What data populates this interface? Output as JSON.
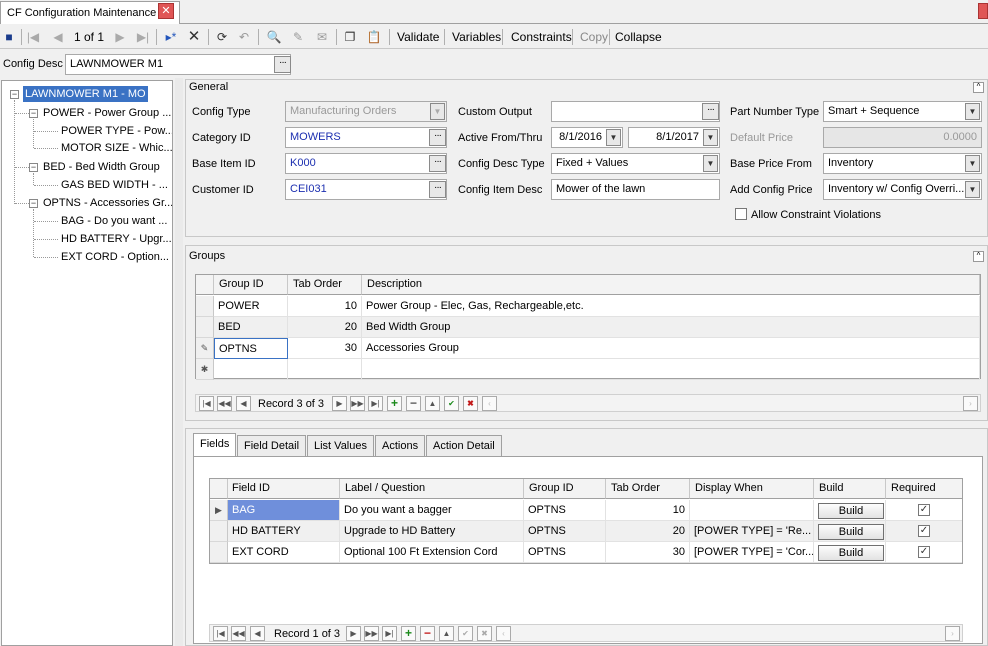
{
  "window": {
    "tab_title": "CF Configuration Maintenance"
  },
  "toolbar": {
    "record_counter": "1 of 1",
    "validate": "Validate",
    "variables": "Variables",
    "constraints": "Constraints",
    "copy": "Copy",
    "collapse": "Collapse"
  },
  "config_desc": {
    "label": "Config Desc",
    "value": "LAWNMOWER M1"
  },
  "tree": {
    "root": "LAWNMOWER M1 - MO",
    "items": [
      {
        "label": "POWER - Power Group ...",
        "level": 1
      },
      {
        "label": "POWER TYPE - Pow...",
        "level": 2
      },
      {
        "label": "MOTOR SIZE - Whic...",
        "level": 2
      },
      {
        "label": "BED - Bed Width Group",
        "level": 1
      },
      {
        "label": "GAS BED WIDTH - ...",
        "level": 2
      },
      {
        "label": "OPTNS - Accessories Gr...",
        "level": 1
      },
      {
        "label": "BAG - Do you want ...",
        "level": 2
      },
      {
        "label": "HD BATTERY - Upgr...",
        "level": 2
      },
      {
        "label": "EXT CORD - Option...",
        "level": 2
      }
    ]
  },
  "general": {
    "title": "General",
    "config_type_label": "Config Type",
    "config_type": "Manufacturing Orders",
    "category_id_label": "Category ID",
    "category_id": "MOWERS",
    "base_item_id_label": "Base Item ID",
    "base_item_id": "K000",
    "customer_id_label": "Customer ID",
    "customer_id": "CEI031",
    "custom_output_label": "Custom Output",
    "custom_output": "",
    "active_label": "Active From/Thru",
    "active_from": "8/1/2016",
    "active_thru": "8/1/2017",
    "config_desc_type_label": "Config Desc Type",
    "config_desc_type": "Fixed + Values",
    "config_item_desc_label": "Config Item Desc",
    "config_item_desc": "Mower of the lawn",
    "part_number_type_label": "Part Number Type",
    "part_number_type": "Smart + Sequence",
    "default_price_label": "Default Price",
    "default_price": "0.0000",
    "base_price_from_label": "Base Price From",
    "base_price_from": "Inventory",
    "add_config_price_label": "Add Config Price",
    "add_config_price": "Inventory w/ Config Overri...",
    "allow_constraint_label": "Allow Constraint Violations"
  },
  "groups": {
    "title": "Groups",
    "headers": [
      "Group ID",
      "Tab Order",
      "Description"
    ],
    "rows": [
      {
        "id": "POWER",
        "order": "10",
        "desc": "Power Group - Elec, Gas, Rechargeable,etc."
      },
      {
        "id": "BED",
        "order": "20",
        "desc": "Bed Width Group"
      },
      {
        "id": "OPTNS",
        "order": "30",
        "desc": "Accessories Group"
      }
    ],
    "record": "Record 3 of 3"
  },
  "detail_tabs": [
    "Fields",
    "Field Detail",
    "List Values",
    "Actions",
    "Action Detail"
  ],
  "fields": {
    "headers": [
      "Field ID",
      "Label / Question",
      "Group ID",
      "Tab Order",
      "Display When",
      "Build",
      "Required"
    ],
    "rows": [
      {
        "id": "BAG",
        "label": "Do you want a bagger",
        "group": "OPTNS",
        "order": "10",
        "when": "",
        "build": "Build",
        "required": true
      },
      {
        "id": "HD BATTERY",
        "label": "Upgrade to HD Battery",
        "group": "OPTNS",
        "order": "20",
        "when": "[POWER TYPE] = 'Re...",
        "build": "Build",
        "required": true
      },
      {
        "id": "EXT CORD",
        "label": "Optional 100 Ft Extension Cord",
        "group": "OPTNS",
        "order": "30",
        "when": "[POWER TYPE] = 'Cor...",
        "build": "Build",
        "required": true
      }
    ],
    "record": "Record 1 of 3"
  },
  "colors": {
    "selection": "#3a72c4",
    "selected_cell": "#6f8fdb",
    "link_text": "#1c2fb0"
  }
}
